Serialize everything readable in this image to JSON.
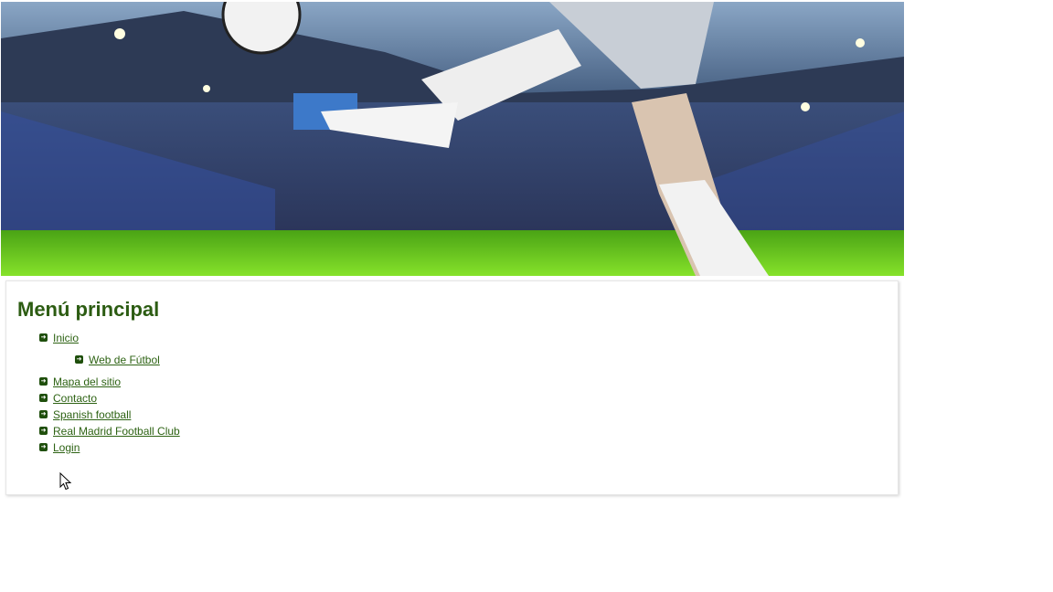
{
  "banner": {
    "image": "soccer-stadium-kick-banner",
    "colors": {
      "sky": "#5d7fa6",
      "crowd": "#2b3b63",
      "grass": "#6fd21c",
      "ball": "#f2f2f2"
    }
  },
  "menu": {
    "title": "Menú principal",
    "items": [
      {
        "label": "Inicio",
        "sub": [
          {
            "label": "Web de Fútbol"
          }
        ]
      },
      {
        "label": "Mapa del sitio"
      },
      {
        "label": "Contacto"
      },
      {
        "label": "Spanish football"
      },
      {
        "label": "Real Madrid Football Club"
      },
      {
        "label": "Login"
      }
    ],
    "colors": {
      "title": "#2c5c12",
      "link": "#2e6314",
      "bullet": "#1f4f0c"
    }
  },
  "icons": {
    "bullet": "arrow-right-bullet-icon",
    "cursor": "mouse-pointer-icon"
  }
}
